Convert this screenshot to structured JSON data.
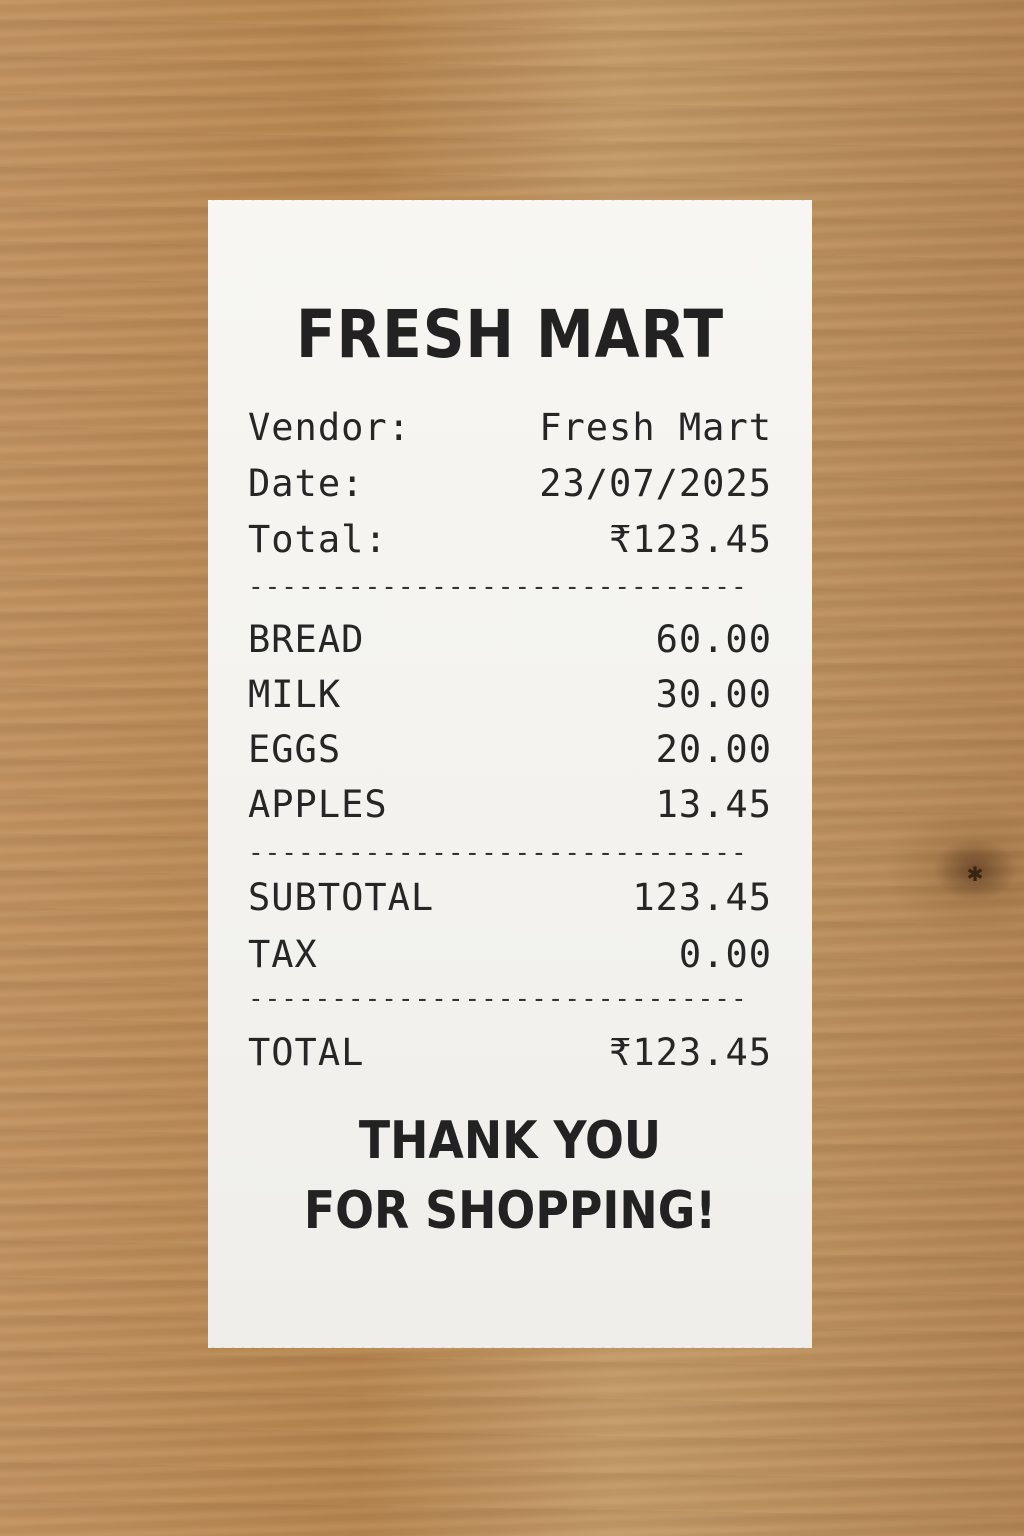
{
  "receipt": {
    "store_name": "FRESH MART",
    "header": [
      {
        "label": "Vendor:",
        "value": "Fresh Mart"
      },
      {
        "label": "Date:",
        "value": "23/07/2025"
      },
      {
        "label": "Total:",
        "value": "₹123.45"
      }
    ],
    "divider": "------------------------------",
    "items": [
      {
        "name": "BREAD",
        "price": "60.00"
      },
      {
        "name": "MILK",
        "price": "30.00"
      },
      {
        "name": "EGGS",
        "price": "20.00"
      },
      {
        "name": "APPLES",
        "price": "13.45"
      }
    ],
    "subtotal": {
      "label": "SUBTOTAL",
      "value": "123.45"
    },
    "tax": {
      "label": "TAX",
      "value": "0.00"
    },
    "total": {
      "label": "TOTAL",
      "value": "₹123.45"
    },
    "footer_line1": "THANK YOU",
    "footer_line2": "FOR SHOPPING!"
  },
  "colors": {
    "paper": "#f5f4f0",
    "ink": "#222222",
    "wood": "#b88a5c"
  }
}
